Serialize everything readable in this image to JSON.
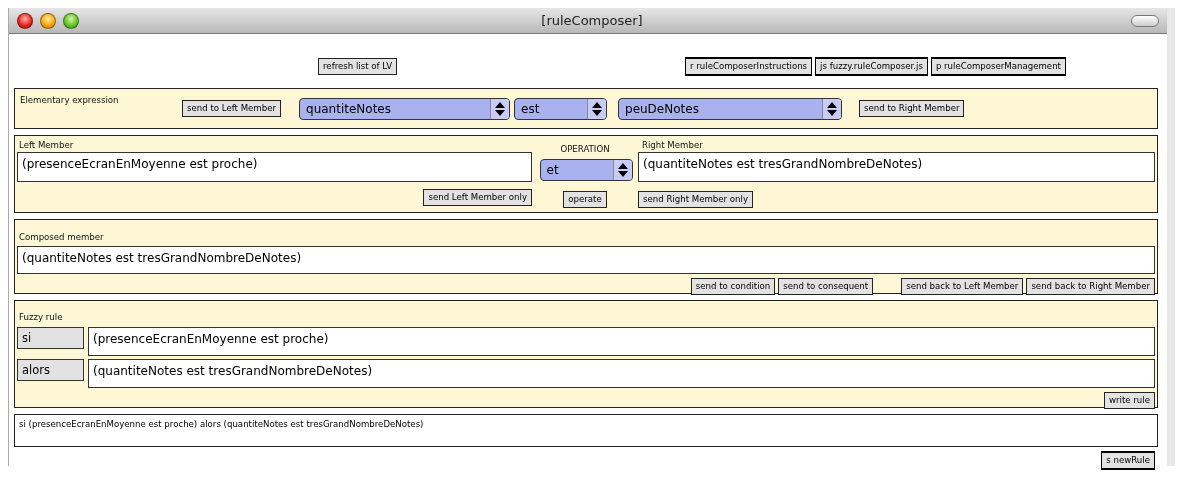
{
  "window": {
    "title": "[ruleComposer]"
  },
  "header_objects": [
    {
      "label": "refresh list of LV",
      "kind": "message"
    },
    {
      "label": "r ruleComposerInstructions",
      "kind": "object"
    },
    {
      "label": "js fuzzy.ruleComposer.js",
      "kind": "object"
    },
    {
      "label": "p ruleComposerManagement",
      "kind": "object"
    }
  ],
  "elementary": {
    "label": "Elementary expression",
    "send_left_button": "send to Left Member",
    "menus": [
      {
        "value": "quantiteNotes"
      },
      {
        "value": "est"
      },
      {
        "value": "peuDeNotes"
      }
    ],
    "send_right_button": "send to Right Member"
  },
  "left_member": {
    "label": "Left Member",
    "value": "(presenceEcranEnMoyenne est proche)",
    "send_button": "send Left Member only"
  },
  "operation": {
    "label": "OPERATION",
    "value": "et",
    "operate_button": "operate"
  },
  "right_member": {
    "label": "Right Member",
    "value": "(quantiteNotes est tresGrandNombreDeNotes)",
    "send_button": "send Right Member only"
  },
  "composed": {
    "label": "Composed member",
    "value": "(quantiteNotes est tresGrandNombreDeNotes)",
    "send_buttons": [
      "send to condition",
      "send to consequent"
    ],
    "back_buttons": [
      "send back to Left Member",
      "send back to Right Member"
    ]
  },
  "fuzzy_rule": {
    "label": "Fuzzy rule",
    "rows": [
      {
        "keyword": "si",
        "value": "(presenceEcranEnMoyenne est proche)"
      },
      {
        "keyword": "alors",
        "value": "(quantiteNotes est tresGrandNombreDeNotes)"
      }
    ],
    "write_button": "write rule"
  },
  "output": {
    "text": "si (presenceEcranEnMoyenne est proche) alors (quantiteNotes est tresGrandNombreDeNotes)"
  },
  "send_object": {
    "label": "s newRule",
    "kind": "object"
  }
}
